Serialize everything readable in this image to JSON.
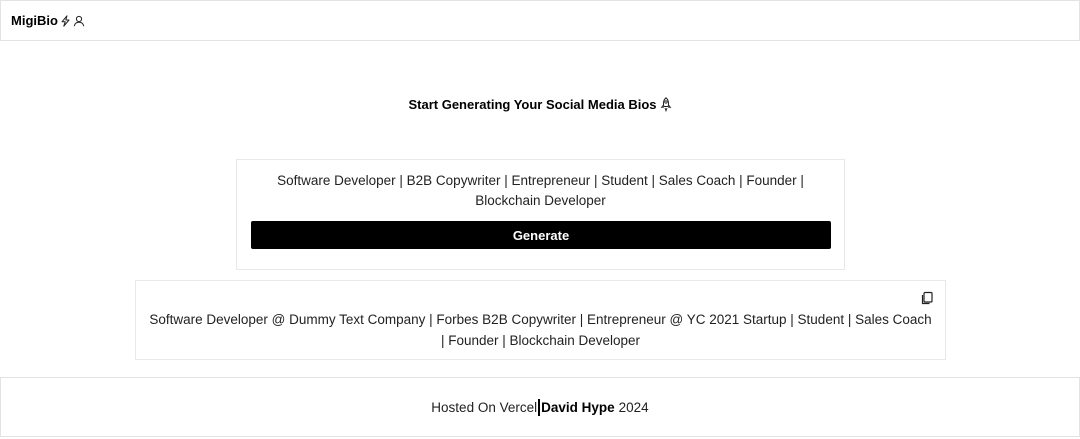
{
  "navbar": {
    "brand": "MigiBio",
    "icons": [
      "bolt-icon",
      "user-icon"
    ]
  },
  "main": {
    "heading": "Start Generating Your Social Media Bios",
    "heading_icon": "rocket-icon",
    "input_text": "Software Developer | B2B Copywriter | Entrepreneur | Student | Sales Coach | Founder | Blockchain Developer",
    "generate_label": "Generate",
    "result_text": "Software Developer @ Dummy Text Company | Forbes B2B Copywriter | Entrepreneur @ YC 2021 Startup | Student | Sales Coach | Founder | Blockchain Developer",
    "copy_icon": "copy-icon"
  },
  "footer": {
    "hosted_text": "Hosted On Vercel",
    "author": "David Hype",
    "year": "2024"
  }
}
